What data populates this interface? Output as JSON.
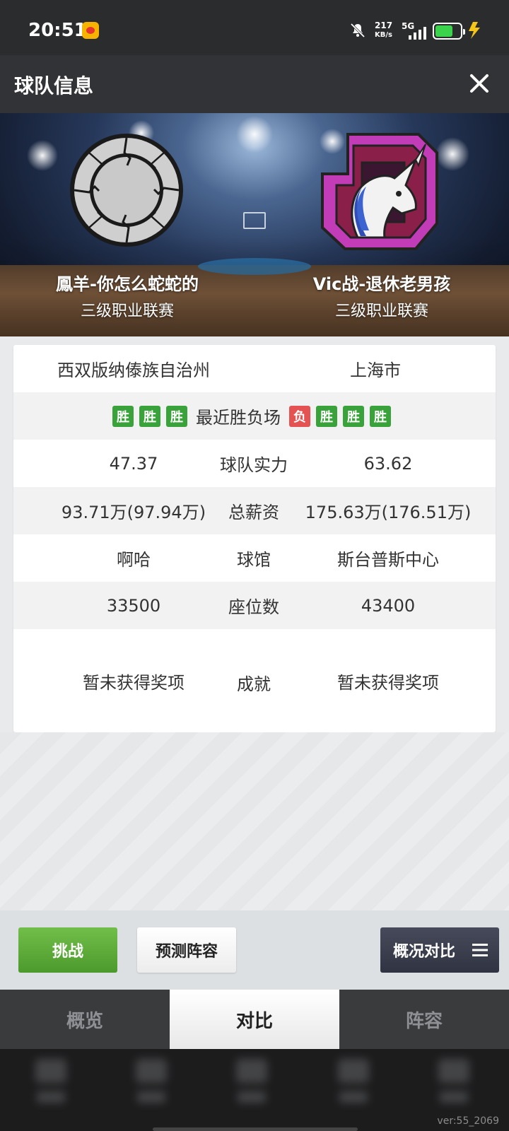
{
  "status_bar": {
    "time": "20:51",
    "net_speed_value": "217",
    "net_speed_unit": "KB/s",
    "network": "5G",
    "icons": [
      "weibo-icon",
      "mute-icon",
      "signal-icon",
      "battery-icon",
      "charging-bolt-icon"
    ]
  },
  "header": {
    "title": "球队信息",
    "close_icon": "close-icon"
  },
  "teams": {
    "left": {
      "name": "鳳羊-你怎么蛇蛇的",
      "league": "三级职业联赛",
      "logo": "cracked-stone-ring-logo"
    },
    "right": {
      "name": "Vic战-退休老男孩",
      "league": "三级职业联赛",
      "logo": "unicorn-crest-logo"
    }
  },
  "compare": {
    "cities": {
      "left": "西双版纳傣族自治州",
      "right": "上海市"
    },
    "recent_form": {
      "label": "最近胜负场",
      "left": [
        "胜",
        "胜",
        "胜"
      ],
      "right": [
        "负",
        "胜",
        "胜",
        "胜"
      ]
    },
    "rows": [
      {
        "label": "球队实力",
        "left": "47.37",
        "right": "63.62"
      },
      {
        "label": "总薪资",
        "left": "93.71万(97.94万)",
        "right": "175.63万(176.51万)"
      },
      {
        "label": "球馆",
        "left": "啊哈",
        "right": "斯台普斯中心"
      },
      {
        "label": "座位数",
        "left": "33500",
        "right": "43400"
      },
      {
        "label": "成就",
        "left": "暂未获得奖项",
        "right": "暂未获得奖项"
      }
    ]
  },
  "actions": {
    "challenge": "挑战",
    "predict": "预测阵容",
    "overview_compare": "概况对比"
  },
  "tabs": [
    {
      "label": "概览",
      "active": false
    },
    {
      "label": "对比",
      "active": true
    },
    {
      "label": "阵容",
      "active": false
    }
  ],
  "version": "ver:55_2069",
  "colors": {
    "win": "#3aa23a",
    "loss": "#e45252",
    "challenge_green": "#5daa38",
    "header_bg": "#323336",
    "logo_magenta": "#c23bb7"
  }
}
